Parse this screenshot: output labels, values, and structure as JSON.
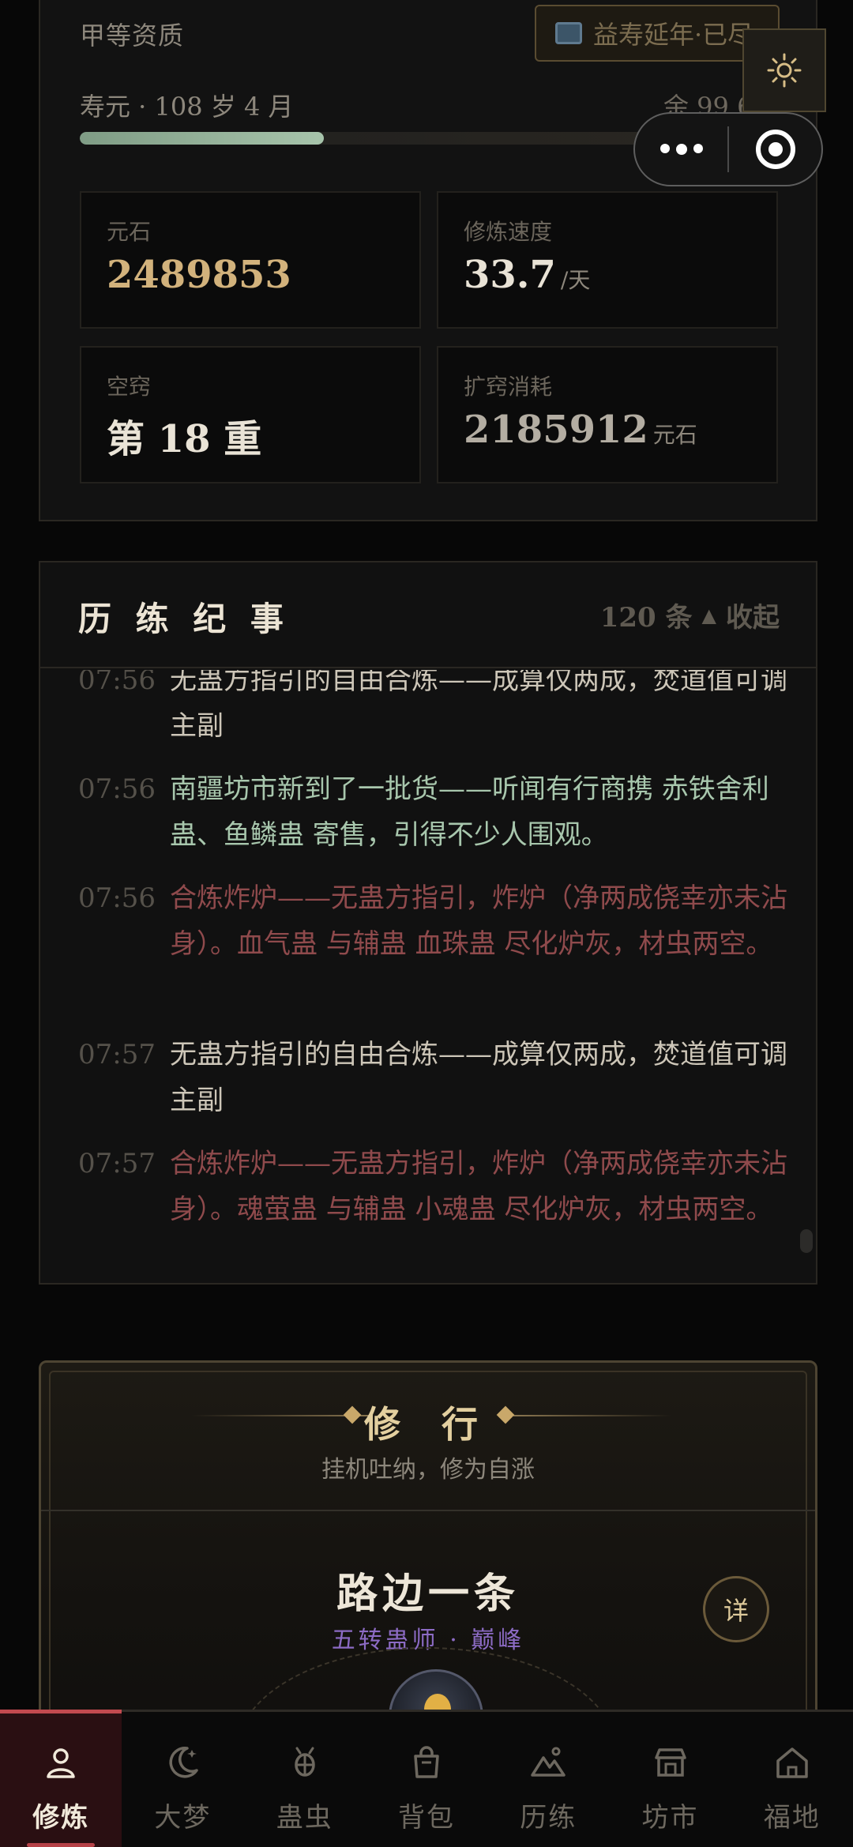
{
  "status": {
    "aptitude": "甲等资质",
    "boon_button": "益寿延年·已尽",
    "lifespan_label": "寿元 · 108 岁 4 月",
    "lifespan_remaining": "余 99.6",
    "lifespan_progress": 0.35,
    "stats": [
      {
        "label": "元石",
        "value": "2489853",
        "unit": ""
      },
      {
        "label": "修炼速度",
        "value": "33.7",
        "unit": "/天"
      },
      {
        "label": "空窍",
        "value": "第 18 重",
        "unit": ""
      },
      {
        "label": "扩窍消耗",
        "value": "2185912",
        "unit": "元石"
      }
    ]
  },
  "controls": {
    "settings_icon": "sun-gear-icon",
    "more_icon": "more-dots-icon",
    "close_icon": "target-icon"
  },
  "log": {
    "title": "历 练 纪 事",
    "count": "120 条",
    "toggle_arrow": "▲",
    "toggle_label": "收起",
    "entries": [
      {
        "time": "07:56",
        "text": "无蛊方指引的自由合炼——成算仅两成，焚道值可调主副",
        "tone": "normal"
      },
      {
        "time": "07:56",
        "text": "南疆坊市新到了一批货——听闻有行商携 赤铁舍利蛊、鱼鳞蛊 寄售，引得不少人围观。",
        "tone": "green"
      },
      {
        "time": "07:56",
        "text": "合炼炸炉——无蛊方指引，炸炉（净两成侥幸亦未沾身）。血气蛊 与辅蛊 血珠蛊 尽化炉灰，材虫两空。",
        "tone": "red"
      },
      {
        "time": "07:57",
        "text": "无蛊方指引的自由合炼——成算仅两成，焚道值可调主副",
        "tone": "normal"
      },
      {
        "time": "07:57",
        "text": "合炼炸炉——无蛊方指引，炸炉（净两成侥幸亦未沾身）。魂萤蛊 与辅蛊 小魂蛊 尽化炉灰，材虫两空。",
        "tone": "red"
      }
    ]
  },
  "cultivation": {
    "title": "修 行",
    "subtitle": "挂机吐纳，修为自涨",
    "path_name": "路边一条",
    "rank": "五转蛊师 · 巅峰",
    "detail_button": "详"
  },
  "nav": {
    "items": [
      {
        "label": "修炼",
        "icon": "person-icon",
        "active": true
      },
      {
        "label": "大梦",
        "icon": "moon-icon",
        "active": false
      },
      {
        "label": "蛊虫",
        "icon": "bug-icon",
        "active": false
      },
      {
        "label": "背包",
        "icon": "bag-icon",
        "active": false
      },
      {
        "label": "历练",
        "icon": "mountain-icon",
        "active": false
      },
      {
        "label": "坊市",
        "icon": "shop-icon",
        "active": false
      },
      {
        "label": "福地",
        "icon": "home-icon",
        "active": false
      }
    ]
  },
  "colors": {
    "accent_gold": "#d2b27c",
    "accent_red": "#c24a4f",
    "log_green": "#a8c7ad",
    "log_red": "#8f4a4c",
    "rank_purple": "#8c6bc4"
  }
}
